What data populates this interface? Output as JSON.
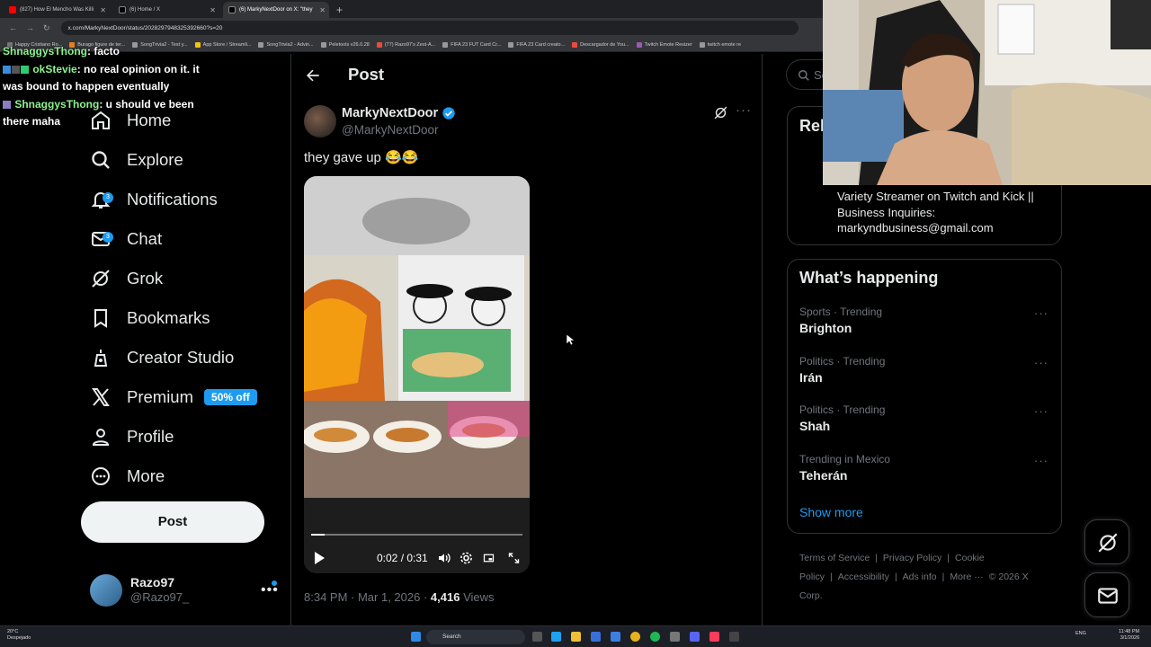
{
  "browser": {
    "tabs": [
      {
        "title": "(827) How El Mencho Was Killi",
        "icon_color": "#ff0000",
        "active": false
      },
      {
        "title": "(6) Home / X",
        "icon_color": "#000000",
        "active": false
      },
      {
        "title": "(6) MarkyNextDoor on X: \"they",
        "icon_color": "#000000",
        "active": true
      }
    ],
    "new_tab": "+",
    "url": "x.com/MarkyNextDoor/status/2028297948325392660?s=20",
    "bookmarks": [
      {
        "label": "Happy Cristiano Ro...",
        "color": "#777777"
      },
      {
        "label": "Burago figure de ter...",
        "color": "#e67e22"
      },
      {
        "label": "SongTrivia2 - Test y...",
        "color": "#999999"
      },
      {
        "label": "App Store / Streamli...",
        "color": "#f1c40f"
      },
      {
        "label": "SongTrivia2 - Advin...",
        "color": "#999999"
      },
      {
        "label": "Peletools v26.0.28",
        "color": "#999999"
      },
      {
        "label": "(77) Razo97's Zest-A...",
        "color": "#e74c3c"
      },
      {
        "label": "FIFA 23 FUT Card Cr...",
        "color": "#999999"
      },
      {
        "label": "FIFA 23 Card creato...",
        "color": "#999999"
      },
      {
        "label": "Descargador de You...",
        "color": "#e74c3c"
      },
      {
        "label": "Twitch Emote Resizer",
        "color": "#9b59b6"
      },
      {
        "label": "twitch emote re",
        "color": "#999999"
      }
    ]
  },
  "chat": {
    "messages": [
      {
        "user": "ShnaggysThong",
        "text": ": facto"
      },
      {
        "user": "okStevie",
        "text": ": no real opinion on it. it was bound to happen eventually"
      },
      {
        "user": "ShnaggysThong",
        "text": ": u should ve been there maha"
      }
    ]
  },
  "sidebar": {
    "items": [
      {
        "label": "Home",
        "icon": "home-icon"
      },
      {
        "label": "Explore",
        "icon": "search-icon"
      },
      {
        "label": "Notifications",
        "icon": "bell-icon",
        "badge": "3"
      },
      {
        "label": "Chat",
        "icon": "mail-icon",
        "badge": "3"
      },
      {
        "label": "Grok",
        "icon": "grok-icon"
      },
      {
        "label": "Bookmarks",
        "icon": "bookmark-icon"
      },
      {
        "label": "Creator Studio",
        "icon": "creator-icon"
      },
      {
        "label": "Premium",
        "icon": "x-logo-icon",
        "pill": "50% off"
      },
      {
        "label": "Profile",
        "icon": "profile-icon"
      },
      {
        "label": "More",
        "icon": "more-circle-icon"
      }
    ],
    "post_button": "Post",
    "account": {
      "name": "Razo97",
      "handle": "@Razo97_",
      "more": "•••"
    }
  },
  "post": {
    "header_title": "Post",
    "author_name": "MarkyNextDoor",
    "author_handle": "@MarkyNextDoor",
    "text": "they gave up 😂😂",
    "more": "···",
    "video": {
      "time": "0:02 / 0:31",
      "progress": 0.065
    },
    "time": "8:34 PM · Mar 1, 2026 · ",
    "views_count": "4,416",
    "views_label": " Views"
  },
  "right": {
    "search_placeholder": "Se",
    "relevant_title": "Rel",
    "bio": "Variety Streamer on Twitch and Kick || Business Inquiries: markyndbusiness@gmail.com",
    "whats_happening": "What’s happening",
    "trends": [
      {
        "context": "Sports · Trending",
        "topic": "Brighton"
      },
      {
        "context": "Politics · Trending",
        "topic": "Irán"
      },
      {
        "context": "Politics · Trending",
        "topic": "Shah"
      },
      {
        "context": "Trending in Mexico",
        "topic": "Teherán"
      }
    ],
    "trend_more": "···",
    "show_more": "Show more",
    "footer": [
      "Terms of Service",
      "|",
      "Privacy Policy",
      "|",
      "Cookie Policy",
      "|",
      "Accessibility",
      "|",
      "Ads info",
      "|",
      "More ···",
      "© 2026 X Corp."
    ]
  },
  "taskbar": {
    "weather_temp": "20°C",
    "weather_desc": "Despejado",
    "search": "Search",
    "lang": "ENG",
    "time": "11:48 PM",
    "date": "3/1/2026"
  },
  "colors": {
    "accent": "#1d9bf0",
    "background": "#000000",
    "muted": "#71767b",
    "border": "#2f3336"
  }
}
